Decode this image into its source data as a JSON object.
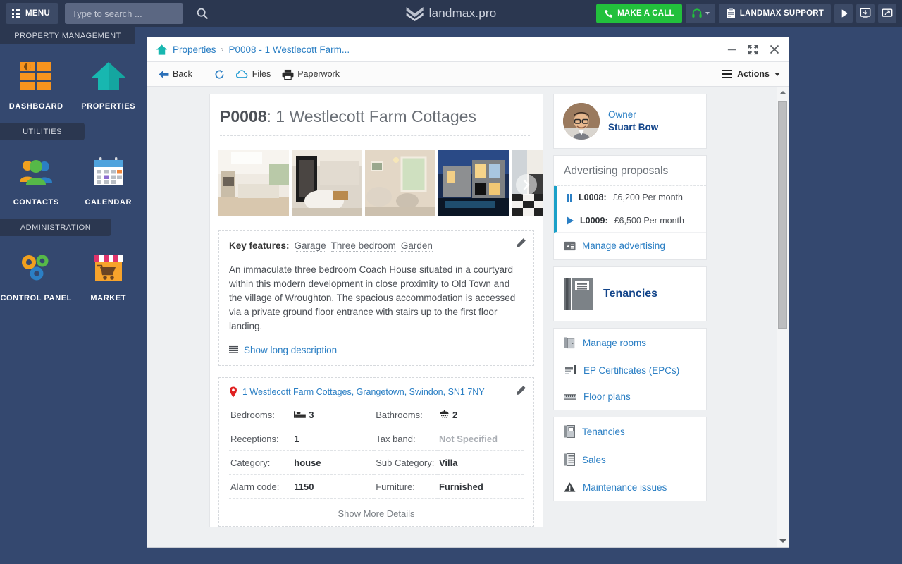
{
  "header": {
    "menu_label": "MENU",
    "search_placeholder": "Type to search ...",
    "search_value": "",
    "brand": "landmax.pro",
    "make_call_label": "MAKE A CALL",
    "support_label": "LANDMAX SUPPORT",
    "icons": {
      "grid": "grid-menu-icon",
      "search": "search-icon",
      "logo": "landmax-chevron-logo",
      "phone": "phone-icon",
      "headset": "headset-icon",
      "clipboard": "clipboard-icon",
      "bell": "bell-icon",
      "download": "download-to-screen-icon",
      "screen": "screen-resize-icon"
    },
    "colors": {
      "bar": "#2b3750",
      "call_green": "#22c03c",
      "button": "#3c4a66"
    }
  },
  "sidebar": {
    "sections": [
      {
        "title": "PROPERTY MANAGEMENT",
        "items": [
          {
            "label": "DASHBOARD",
            "icon": "dashboard-grid-icon"
          },
          {
            "label": "PROPERTIES",
            "icon": "house-icon"
          }
        ]
      },
      {
        "title": "UTILITIES",
        "items": [
          {
            "label": "CONTACTS",
            "icon": "contacts-people-icon"
          },
          {
            "label": "CALENDAR",
            "icon": "calendar-icon"
          }
        ]
      },
      {
        "title": "ADMINISTRATION",
        "items": [
          {
            "label": "CONTROL PANEL",
            "icon": "gears-icon"
          },
          {
            "label": "MARKET",
            "icon": "market-shop-icon"
          }
        ]
      }
    ],
    "colors": {
      "bg": "#34486f",
      "section_bg": "#2b3750"
    }
  },
  "window": {
    "breadcrumb": {
      "home_icon": "home-house-icon",
      "root": "Properties",
      "separator": "›",
      "current": "P0008 - 1 Westlecott Farm..."
    },
    "controls": {
      "minimize": "minimize-icon",
      "restore": "restore-expand-icon",
      "close": "close-icon"
    },
    "toolbar": {
      "back_label": "Back",
      "refresh_icon": "refresh-icon",
      "files_label": "Files",
      "paperwork_label": "Paperwork",
      "actions_label": "Actions"
    }
  },
  "property": {
    "ref": "P0008",
    "name": "1 Westlecott Farm Cottages",
    "title_separator": ": ",
    "gallery": {
      "next_icon": "chevron-right-icon",
      "photos": [
        {
          "alt": "kitchen-photo"
        },
        {
          "alt": "living-room-photo"
        },
        {
          "alt": "lounge-photo"
        },
        {
          "alt": "exterior-night-photo"
        },
        {
          "alt": "hallway-photo"
        }
      ]
    },
    "key_features_label": "Key features:",
    "key_features": [
      "Garage",
      "Three bedroom",
      "Garden"
    ],
    "description": "An immaculate three bedroom Coach House situated in a courtyard within this modern development in close proximity to Old Town and the village of Wroughton. The spacious accommodation is accessed via a private ground floor entrance with stairs up to the first floor landing.",
    "show_long_description": "Show long description",
    "address": "1 Westlecott Farm Cottages, Grangetown, Swindon, SN1 7NY",
    "details": [
      {
        "key": "Bedrooms:",
        "value": "3",
        "icon": "bed-icon",
        "key2": "Bathrooms:",
        "value2": "2",
        "icon2": "shower-icon",
        "muted2": false
      },
      {
        "key": "Receptions:",
        "value": "1",
        "icon": "",
        "key2": "Tax band:",
        "value2": "Not Specified",
        "icon2": "",
        "muted2": true
      },
      {
        "key": "Category:",
        "value": "house",
        "icon": "",
        "key2": "Sub Category:",
        "value2": "Villa",
        "icon2": "",
        "muted2": false
      },
      {
        "key": "Alarm code:",
        "value": "1150",
        "icon": "",
        "key2": "Furniture:",
        "value2": "Furnished",
        "icon2": "",
        "muted2": false
      }
    ],
    "show_more_details": "Show More Details"
  },
  "owner": {
    "role_label": "Owner",
    "name": "Stuart Bow",
    "avatar_icon": "avatar"
  },
  "advertising": {
    "title": "Advertising proposals",
    "rows": [
      {
        "ref": "L0008:",
        "amount": "£6,200 Per month",
        "icon": "pause-icon"
      },
      {
        "ref": "L0009:",
        "amount": "£6,500 Per month",
        "icon": "play-icon"
      }
    ],
    "manage_label": "Manage advertising",
    "manage_icon": "advert-board-icon",
    "accent": "#1aa0c8"
  },
  "tenancies_card": {
    "title": "Tenancies",
    "icon": "book-icon"
  },
  "links_group_1": [
    {
      "label": "Manage rooms",
      "icon": "door-icon"
    },
    {
      "label": "EP Certificates (EPCs)",
      "icon": "epc-chart-icon"
    },
    {
      "label": "Floor plans",
      "icon": "ruler-icon"
    }
  ],
  "links_group_2": [
    {
      "label": "Tenancies",
      "icon": "book-small-icon"
    },
    {
      "label": "Sales",
      "icon": "ledger-icon"
    },
    {
      "label": "Maintenance issues",
      "icon": "warning-triangle-icon"
    }
  ]
}
